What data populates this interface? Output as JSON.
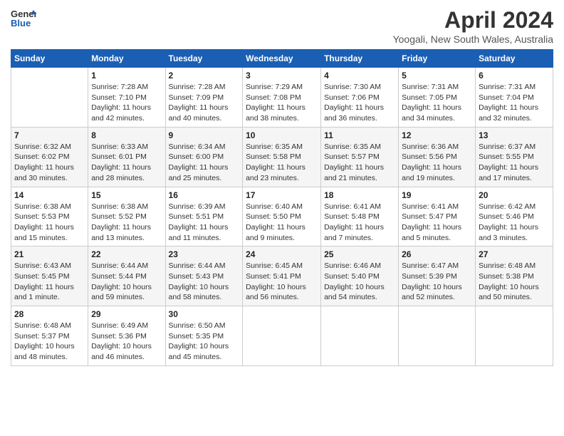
{
  "header": {
    "logo_line1": "General",
    "logo_line2": "Blue",
    "month": "April 2024",
    "location": "Yoogali, New South Wales, Australia"
  },
  "weekdays": [
    "Sunday",
    "Monday",
    "Tuesday",
    "Wednesday",
    "Thursday",
    "Friday",
    "Saturday"
  ],
  "weeks": [
    [
      {
        "day": "",
        "info": ""
      },
      {
        "day": "1",
        "info": "Sunrise: 7:28 AM\nSunset: 7:10 PM\nDaylight: 11 hours\nand 42 minutes."
      },
      {
        "day": "2",
        "info": "Sunrise: 7:28 AM\nSunset: 7:09 PM\nDaylight: 11 hours\nand 40 minutes."
      },
      {
        "day": "3",
        "info": "Sunrise: 7:29 AM\nSunset: 7:08 PM\nDaylight: 11 hours\nand 38 minutes."
      },
      {
        "day": "4",
        "info": "Sunrise: 7:30 AM\nSunset: 7:06 PM\nDaylight: 11 hours\nand 36 minutes."
      },
      {
        "day": "5",
        "info": "Sunrise: 7:31 AM\nSunset: 7:05 PM\nDaylight: 11 hours\nand 34 minutes."
      },
      {
        "day": "6",
        "info": "Sunrise: 7:31 AM\nSunset: 7:04 PM\nDaylight: 11 hours\nand 32 minutes."
      }
    ],
    [
      {
        "day": "7",
        "info": "Sunrise: 6:32 AM\nSunset: 6:02 PM\nDaylight: 11 hours\nand 30 minutes."
      },
      {
        "day": "8",
        "info": "Sunrise: 6:33 AM\nSunset: 6:01 PM\nDaylight: 11 hours\nand 28 minutes."
      },
      {
        "day": "9",
        "info": "Sunrise: 6:34 AM\nSunset: 6:00 PM\nDaylight: 11 hours\nand 25 minutes."
      },
      {
        "day": "10",
        "info": "Sunrise: 6:35 AM\nSunset: 5:58 PM\nDaylight: 11 hours\nand 23 minutes."
      },
      {
        "day": "11",
        "info": "Sunrise: 6:35 AM\nSunset: 5:57 PM\nDaylight: 11 hours\nand 21 minutes."
      },
      {
        "day": "12",
        "info": "Sunrise: 6:36 AM\nSunset: 5:56 PM\nDaylight: 11 hours\nand 19 minutes."
      },
      {
        "day": "13",
        "info": "Sunrise: 6:37 AM\nSunset: 5:55 PM\nDaylight: 11 hours\nand 17 minutes."
      }
    ],
    [
      {
        "day": "14",
        "info": "Sunrise: 6:38 AM\nSunset: 5:53 PM\nDaylight: 11 hours\nand 15 minutes."
      },
      {
        "day": "15",
        "info": "Sunrise: 6:38 AM\nSunset: 5:52 PM\nDaylight: 11 hours\nand 13 minutes."
      },
      {
        "day": "16",
        "info": "Sunrise: 6:39 AM\nSunset: 5:51 PM\nDaylight: 11 hours\nand 11 minutes."
      },
      {
        "day": "17",
        "info": "Sunrise: 6:40 AM\nSunset: 5:50 PM\nDaylight: 11 hours\nand 9 minutes."
      },
      {
        "day": "18",
        "info": "Sunrise: 6:41 AM\nSunset: 5:48 PM\nDaylight: 11 hours\nand 7 minutes."
      },
      {
        "day": "19",
        "info": "Sunrise: 6:41 AM\nSunset: 5:47 PM\nDaylight: 11 hours\nand 5 minutes."
      },
      {
        "day": "20",
        "info": "Sunrise: 6:42 AM\nSunset: 5:46 PM\nDaylight: 11 hours\nand 3 minutes."
      }
    ],
    [
      {
        "day": "21",
        "info": "Sunrise: 6:43 AM\nSunset: 5:45 PM\nDaylight: 11 hours\nand 1 minute."
      },
      {
        "day": "22",
        "info": "Sunrise: 6:44 AM\nSunset: 5:44 PM\nDaylight: 10 hours\nand 59 minutes."
      },
      {
        "day": "23",
        "info": "Sunrise: 6:44 AM\nSunset: 5:43 PM\nDaylight: 10 hours\nand 58 minutes."
      },
      {
        "day": "24",
        "info": "Sunrise: 6:45 AM\nSunset: 5:41 PM\nDaylight: 10 hours\nand 56 minutes."
      },
      {
        "day": "25",
        "info": "Sunrise: 6:46 AM\nSunset: 5:40 PM\nDaylight: 10 hours\nand 54 minutes."
      },
      {
        "day": "26",
        "info": "Sunrise: 6:47 AM\nSunset: 5:39 PM\nDaylight: 10 hours\nand 52 minutes."
      },
      {
        "day": "27",
        "info": "Sunrise: 6:48 AM\nSunset: 5:38 PM\nDaylight: 10 hours\nand 50 minutes."
      }
    ],
    [
      {
        "day": "28",
        "info": "Sunrise: 6:48 AM\nSunset: 5:37 PM\nDaylight: 10 hours\nand 48 minutes."
      },
      {
        "day": "29",
        "info": "Sunrise: 6:49 AM\nSunset: 5:36 PM\nDaylight: 10 hours\nand 46 minutes."
      },
      {
        "day": "30",
        "info": "Sunrise: 6:50 AM\nSunset: 5:35 PM\nDaylight: 10 hours\nand 45 minutes."
      },
      {
        "day": "",
        "info": ""
      },
      {
        "day": "",
        "info": ""
      },
      {
        "day": "",
        "info": ""
      },
      {
        "day": "",
        "info": ""
      }
    ]
  ]
}
